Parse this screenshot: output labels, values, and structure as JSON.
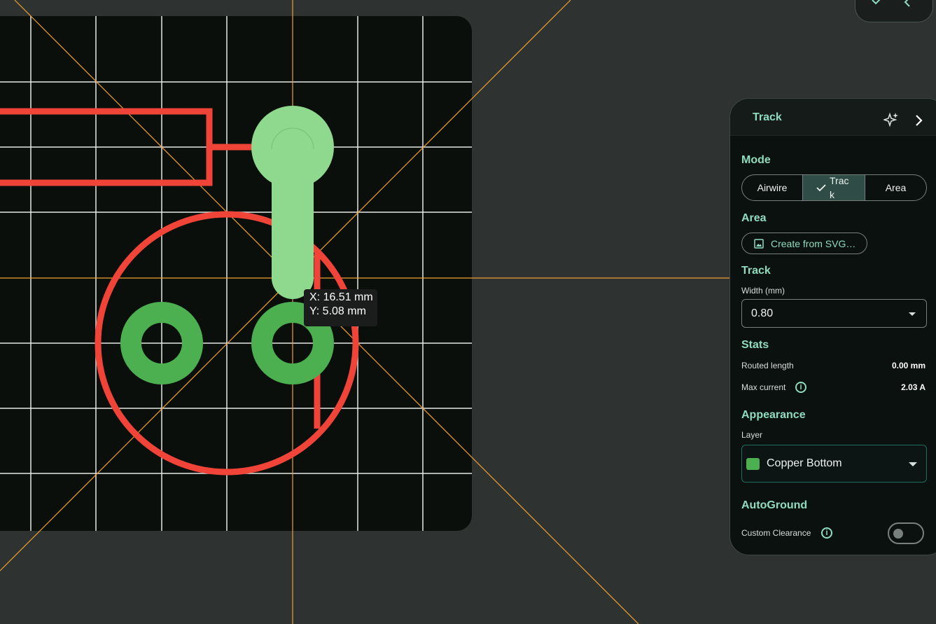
{
  "toolbar_fragment": {
    "icon_left": "check-icon",
    "icon_right": "chevron-left-icon"
  },
  "canvas": {
    "tooltip_x": "X: 16.51 mm",
    "tooltip_y": "Y: 5.08 mm",
    "colors": {
      "board": "#0a0f0b",
      "grid": "#ffffff",
      "guides": "#f0a030",
      "outline": "#f04438",
      "pad_bottom": "#4caf50",
      "track_preview": "#8fd98f"
    }
  },
  "panel": {
    "title": "Track",
    "mode": {
      "heading": "Mode",
      "options": [
        "Airwire",
        "Track",
        "Area"
      ],
      "selected": "Track"
    },
    "area": {
      "heading": "Area",
      "create_button": "Create from SVG…"
    },
    "track": {
      "heading": "Track",
      "width_label": "Width (mm)",
      "width_value": "0.80"
    },
    "stats": {
      "heading": "Stats",
      "routed_label": "Routed length",
      "routed_value": "0.00 mm",
      "current_label": "Max current",
      "current_value": "2.03 A"
    },
    "appearance": {
      "heading": "Appearance",
      "layer_label": "Layer",
      "layer_value": "Copper Bottom",
      "layer_color": "#4caf50"
    },
    "autoground": {
      "heading": "AutoGround",
      "clearance_label": "Custom Clearance",
      "clearance_enabled": false
    }
  }
}
